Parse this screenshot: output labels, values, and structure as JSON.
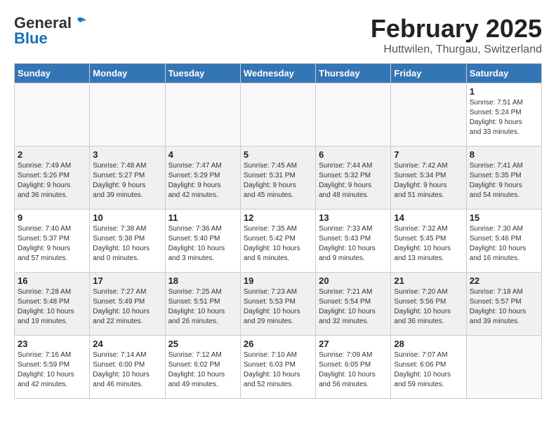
{
  "header": {
    "logo_general": "General",
    "logo_blue": "Blue",
    "month_title": "February 2025",
    "location": "Huttwilen, Thurgau, Switzerland"
  },
  "days_of_week": [
    "Sunday",
    "Monday",
    "Tuesday",
    "Wednesday",
    "Thursday",
    "Friday",
    "Saturday"
  ],
  "weeks": [
    [
      {
        "day": "",
        "info": ""
      },
      {
        "day": "",
        "info": ""
      },
      {
        "day": "",
        "info": ""
      },
      {
        "day": "",
        "info": ""
      },
      {
        "day": "",
        "info": ""
      },
      {
        "day": "",
        "info": ""
      },
      {
        "day": "1",
        "info": "Sunrise: 7:51 AM\nSunset: 5:24 PM\nDaylight: 9 hours\nand 33 minutes."
      }
    ],
    [
      {
        "day": "2",
        "info": "Sunrise: 7:49 AM\nSunset: 5:26 PM\nDaylight: 9 hours\nand 36 minutes."
      },
      {
        "day": "3",
        "info": "Sunrise: 7:48 AM\nSunset: 5:27 PM\nDaylight: 9 hours\nand 39 minutes."
      },
      {
        "day": "4",
        "info": "Sunrise: 7:47 AM\nSunset: 5:29 PM\nDaylight: 9 hours\nand 42 minutes."
      },
      {
        "day": "5",
        "info": "Sunrise: 7:45 AM\nSunset: 5:31 PM\nDaylight: 9 hours\nand 45 minutes."
      },
      {
        "day": "6",
        "info": "Sunrise: 7:44 AM\nSunset: 5:32 PM\nDaylight: 9 hours\nand 48 minutes."
      },
      {
        "day": "7",
        "info": "Sunrise: 7:42 AM\nSunset: 5:34 PM\nDaylight: 9 hours\nand 51 minutes."
      },
      {
        "day": "8",
        "info": "Sunrise: 7:41 AM\nSunset: 5:35 PM\nDaylight: 9 hours\nand 54 minutes."
      }
    ],
    [
      {
        "day": "9",
        "info": "Sunrise: 7:40 AM\nSunset: 5:37 PM\nDaylight: 9 hours\nand 57 minutes."
      },
      {
        "day": "10",
        "info": "Sunrise: 7:38 AM\nSunset: 5:38 PM\nDaylight: 10 hours\nand 0 minutes."
      },
      {
        "day": "11",
        "info": "Sunrise: 7:36 AM\nSunset: 5:40 PM\nDaylight: 10 hours\nand 3 minutes."
      },
      {
        "day": "12",
        "info": "Sunrise: 7:35 AM\nSunset: 5:42 PM\nDaylight: 10 hours\nand 6 minutes."
      },
      {
        "day": "13",
        "info": "Sunrise: 7:33 AM\nSunset: 5:43 PM\nDaylight: 10 hours\nand 9 minutes."
      },
      {
        "day": "14",
        "info": "Sunrise: 7:32 AM\nSunset: 5:45 PM\nDaylight: 10 hours\nand 13 minutes."
      },
      {
        "day": "15",
        "info": "Sunrise: 7:30 AM\nSunset: 5:46 PM\nDaylight: 10 hours\nand 16 minutes."
      }
    ],
    [
      {
        "day": "16",
        "info": "Sunrise: 7:28 AM\nSunset: 5:48 PM\nDaylight: 10 hours\nand 19 minutes."
      },
      {
        "day": "17",
        "info": "Sunrise: 7:27 AM\nSunset: 5:49 PM\nDaylight: 10 hours\nand 22 minutes."
      },
      {
        "day": "18",
        "info": "Sunrise: 7:25 AM\nSunset: 5:51 PM\nDaylight: 10 hours\nand 26 minutes."
      },
      {
        "day": "19",
        "info": "Sunrise: 7:23 AM\nSunset: 5:53 PM\nDaylight: 10 hours\nand 29 minutes."
      },
      {
        "day": "20",
        "info": "Sunrise: 7:21 AM\nSunset: 5:54 PM\nDaylight: 10 hours\nand 32 minutes."
      },
      {
        "day": "21",
        "info": "Sunrise: 7:20 AM\nSunset: 5:56 PM\nDaylight: 10 hours\nand 36 minutes."
      },
      {
        "day": "22",
        "info": "Sunrise: 7:18 AM\nSunset: 5:57 PM\nDaylight: 10 hours\nand 39 minutes."
      }
    ],
    [
      {
        "day": "23",
        "info": "Sunrise: 7:16 AM\nSunset: 5:59 PM\nDaylight: 10 hours\nand 42 minutes."
      },
      {
        "day": "24",
        "info": "Sunrise: 7:14 AM\nSunset: 6:00 PM\nDaylight: 10 hours\nand 46 minutes."
      },
      {
        "day": "25",
        "info": "Sunrise: 7:12 AM\nSunset: 6:02 PM\nDaylight: 10 hours\nand 49 minutes."
      },
      {
        "day": "26",
        "info": "Sunrise: 7:10 AM\nSunset: 6:03 PM\nDaylight: 10 hours\nand 52 minutes."
      },
      {
        "day": "27",
        "info": "Sunrise: 7:09 AM\nSunset: 6:05 PM\nDaylight: 10 hours\nand 56 minutes."
      },
      {
        "day": "28",
        "info": "Sunrise: 7:07 AM\nSunset: 6:06 PM\nDaylight: 10 hours\nand 59 minutes."
      },
      {
        "day": "",
        "info": ""
      }
    ]
  ]
}
